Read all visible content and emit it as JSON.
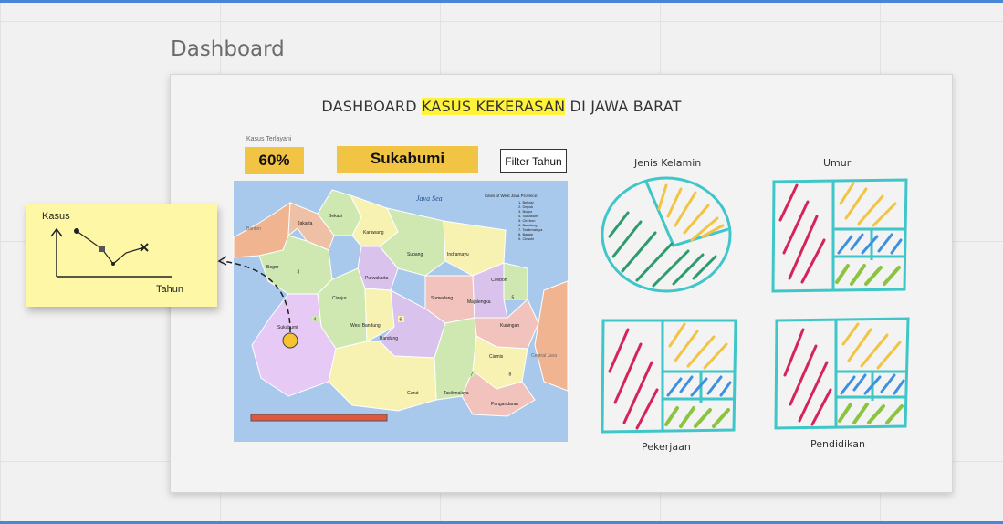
{
  "frame": {
    "title": "Dashboard"
  },
  "dashboard": {
    "title_before": "DASHBOARD ",
    "title_highlight": "KASUS KEKERASAN",
    "title_after": " DI JAWA BARAT",
    "kpi_label": "Kasus Terlayani",
    "kpi_value": "60%",
    "region_value": "Sukabumi",
    "filter_label": "Filter Tahun"
  },
  "map": {
    "sea_label": "Java Sea",
    "legend_title": "Cities of West Java Province:",
    "legend_items": [
      "1. Bekasi",
      "2. Depok",
      "3. Bogor",
      "4. Sukabumi",
      "5. Cirebon",
      "6. Bandung",
      "7. Tasikmalaya",
      "8. Banjar",
      "9. Cimahi"
    ],
    "regions": {
      "bekasi": "Bekasi",
      "karawang": "Karawang",
      "subang": "Subang",
      "indramayu": "Indramayu",
      "bogor": "Bogor",
      "purwakarta": "Purwakarta",
      "cirebon": "Cirebon",
      "sumedang": "Sumedang",
      "majalengka": "Majalengka",
      "cianjur": "Cianjur",
      "kuningan": "Kuningan",
      "west_bandung": "West Bandung",
      "bandung": "Bandung",
      "sukabumi": "Sukabumi",
      "ciamis": "Ciamis",
      "garut": "Garut",
      "tasikmalaya": "Tasikmalaya",
      "pangandaran": "Pangandaran",
      "banten": "Banten",
      "jakarta": "Jakarta",
      "central_java": "Central Java"
    },
    "city_numbers": [
      "1",
      "2",
      "3",
      "4",
      "5",
      "6",
      "7",
      "8",
      "9"
    ],
    "marker_color": "#f5c230",
    "slider_color": "#e05840"
  },
  "charts": {
    "gender": "Jenis Kelamin",
    "age": "Umur",
    "job": "Pekerjaan",
    "education": "Pendidikan"
  },
  "sticky_note": {
    "y_label": "Kasus",
    "x_label": "Tahun"
  },
  "colors": {
    "accent_blue": "#4a86d8",
    "kpi_yellow": "#f1c443",
    "sketch_teal": "#3ec6c8",
    "sketch_pink": "#d4245a",
    "sketch_yellow": "#f1c443",
    "sketch_blue": "#3d8fe0",
    "sketch_green": "#8ac440",
    "sticky_yellow": "#fdf7a6"
  }
}
